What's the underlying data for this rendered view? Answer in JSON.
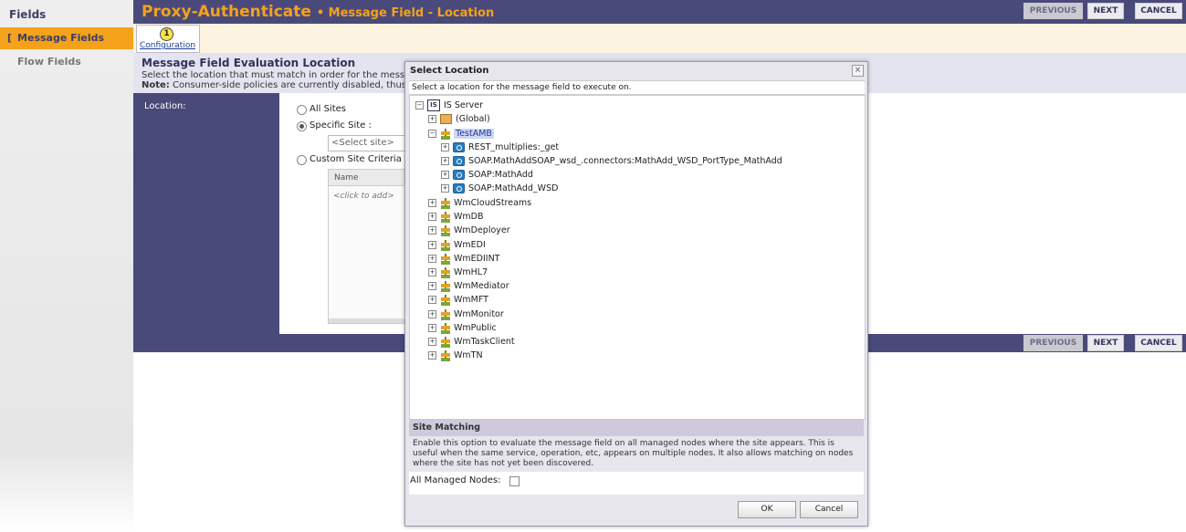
{
  "sidebar": {
    "title": "Fields",
    "items": [
      {
        "label": "Message Fields",
        "bracket": "["
      },
      {
        "label": "Flow Fields"
      }
    ]
  },
  "header": {
    "title": "Proxy-Authenticate",
    "subtitle": "• Message Field - Location",
    "buttons": {
      "previous": "PREVIOUS",
      "next": "NEXT",
      "cancel": "CANCEL"
    }
  },
  "steps": [
    {
      "number": "1",
      "label": "Configuration"
    }
  ],
  "section": {
    "title": "Message Field Evaluation Location",
    "description": "Select the location that must match in order for the messag",
    "note_label": "Note:",
    "note": "Consumer-side policies are currently disabled, thus or"
  },
  "form": {
    "location_label": "Location:",
    "options": {
      "all_sites": "All Sites",
      "specific_site": "Specific Site :",
      "custom": "Custom Site Criteria :"
    },
    "selected_option": "specific_site",
    "select_site_placeholder": "<Select site>",
    "grid_header": "Name",
    "grid_empty": "<click to add>"
  },
  "bottom_buttons": {
    "previous": "PREVIOUS",
    "next": "NEXT",
    "cancel": "CANCEL"
  },
  "modal": {
    "title": "Select Location",
    "close": "×",
    "subtitle": "Select a location for the message field to execute on.",
    "tree": {
      "root": {
        "label": "IS Server",
        "icon": "server-icon",
        "toggle": "−"
      },
      "global": {
        "label": "(Global)",
        "toggle": "+"
      },
      "selected": {
        "label": "TestAMB",
        "toggle": "−"
      },
      "services": [
        {
          "label": "REST_multiplies:_get"
        },
        {
          "label": "SOAP.MathAddSOAP_wsd_.connectors:MathAdd_WSD_PortType_MathAdd"
        },
        {
          "label": "SOAP:MathAdd"
        },
        {
          "label": "SOAP:MathAdd_WSD"
        }
      ],
      "packages": [
        {
          "label": "WmCloudStreams"
        },
        {
          "label": "WmDB"
        },
        {
          "label": "WmDeployer"
        },
        {
          "label": "WmEDI"
        },
        {
          "label": "WmEDIINT"
        },
        {
          "label": "WmHL7"
        },
        {
          "label": "WmMediator"
        },
        {
          "label": "WmMFT"
        },
        {
          "label": "WmMonitor"
        },
        {
          "label": "WmPublic"
        },
        {
          "label": "WmTaskClient"
        },
        {
          "label": "WmTN"
        }
      ]
    },
    "site_matching": {
      "title": "Site Matching",
      "description": "Enable this option to evaluate the message field on all managed nodes where the site appears. This is useful when the same service, operation, etc, appears on multiple nodes. It also allows matching on nodes where the site has not yet been discovered.",
      "checkbox_label": "All Managed Nodes:",
      "checked": false
    },
    "ok": "OK",
    "cancel": "Cancel"
  },
  "colors": {
    "header_bg": "#4a4a7a",
    "accent": "#f4a21a",
    "section_bg": "#e4e4f0"
  }
}
